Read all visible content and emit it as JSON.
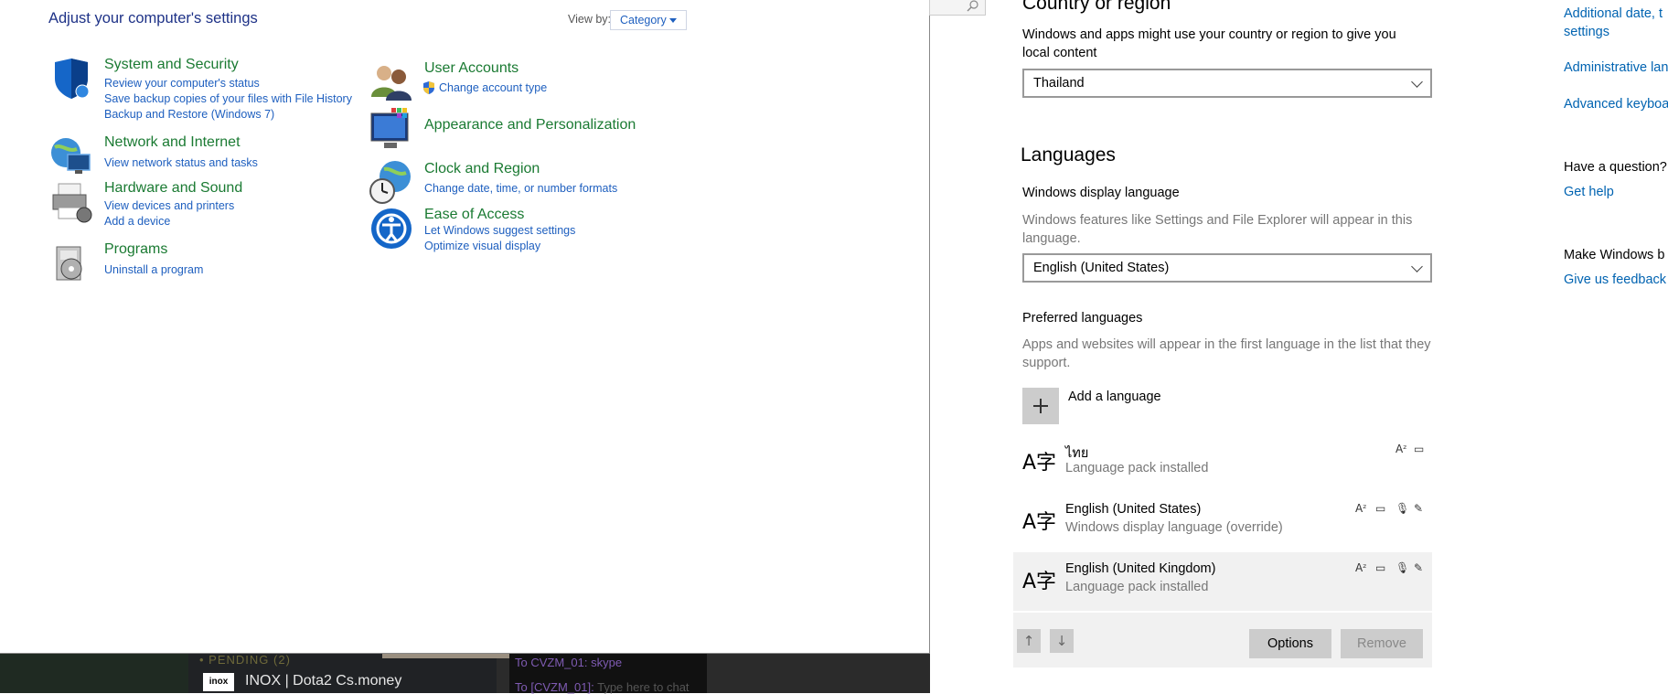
{
  "control_panel": {
    "title": "Adjust your computer's settings",
    "view_by_label": "View by:",
    "view_by_value": "Category",
    "categories_left": [
      {
        "title": "System and Security",
        "links": [
          "Review your computer's status",
          "Save backup copies of your files with File History",
          "Backup and Restore (Windows 7)"
        ],
        "icon": "shield-icon"
      },
      {
        "title": "Network and Internet",
        "links": [
          "View network status and tasks"
        ],
        "icon": "network-globe-icon"
      },
      {
        "title": "Hardware and Sound",
        "links": [
          "View devices and printers",
          "Add a device"
        ],
        "icon": "printer-icon"
      },
      {
        "title": "Programs",
        "links": [
          "Uninstall a program"
        ],
        "icon": "programs-disk-icon"
      }
    ],
    "categories_right": [
      {
        "title": "User Accounts",
        "links": [
          "Change account type"
        ],
        "icon": "users-icon"
      },
      {
        "title": "Appearance and Personalization",
        "links": [],
        "icon": "monitor-palette-icon"
      },
      {
        "title": "Clock and Region",
        "links": [
          "Change date, time, or number formats"
        ],
        "icon": "clock-globe-icon"
      },
      {
        "title": "Ease of Access",
        "links": [
          "Let Windows suggest settings",
          "Optimize visual display"
        ],
        "icon": "ease-of-access-icon"
      }
    ]
  },
  "background_app": {
    "pending": "• PENDING (2)",
    "logo": "inox",
    "entry": "INOX | Dota2 Cs.money",
    "chat_line1": "To CVZM_01: skype",
    "chat_line2_prefix": "To [CVZM_01]:",
    "chat_line2_placeholder": "Type here to chat"
  },
  "settings": {
    "country_heading": "Country or region",
    "country_desc": "Windows and apps might use your country or region to give you local content",
    "country_value": "Thailand",
    "languages_heading": "Languages",
    "display_language_label": "Windows display language",
    "display_language_desc": "Windows features like Settings and File Explorer will appear in this language.",
    "display_language_value": "English (United States)",
    "preferred_label": "Preferred languages",
    "preferred_desc": "Apps and websites will appear in the first language in the list that they support.",
    "add_language": "Add a language",
    "languages": [
      {
        "name": "ไทย",
        "status": "Language pack installed"
      },
      {
        "name": "English (United States)",
        "status": "Windows display language (override)"
      },
      {
        "name": "English (United Kingdom)",
        "status": "Language pack installed"
      }
    ],
    "language_glyph": "A字",
    "options_button": "Options",
    "remove_button": "Remove",
    "move_up": "↑",
    "move_down": "↓"
  },
  "related": {
    "link1": "Additional date, t",
    "link1b": "settings",
    "link2": "Administrative lan",
    "link3": "Advanced keyboa",
    "question_heading": "Have a question?",
    "get_help": "Get help",
    "feedback_heading": "Make Windows b",
    "give_feedback": "Give us feedback"
  }
}
